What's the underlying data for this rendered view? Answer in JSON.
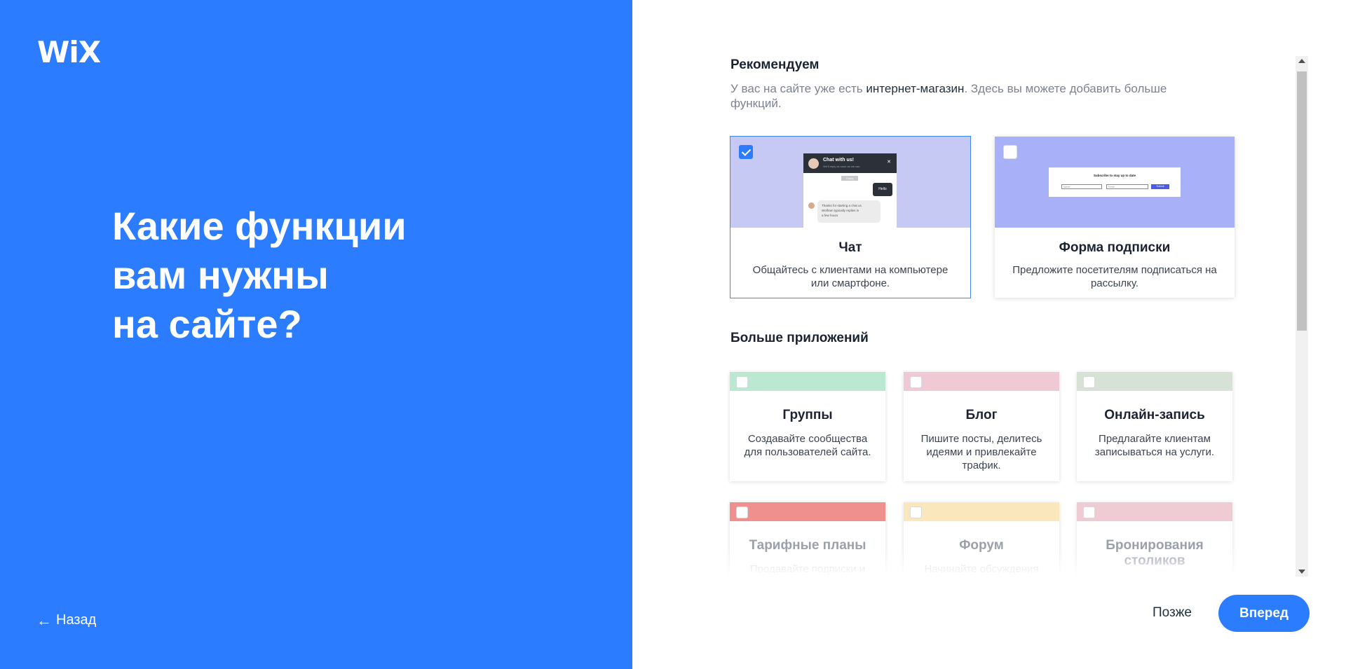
{
  "left": {
    "logo": "WiX",
    "headline": [
      "Какие функции",
      "вам нужны",
      "на сайте?"
    ],
    "back_label": "Назад",
    "back_arrow": "←"
  },
  "recommended": {
    "title": "Рекомендуем",
    "subtitle_before": "У вас на сайте уже есть ",
    "subtitle_emph": "интернет-магазин",
    "subtitle_after": ". Здесь вы можете добавить больше функций.",
    "cards": [
      {
        "title": "Чат",
        "desc": "Общайтесь с клиентами на компьютере или смартфоне.",
        "checked": true,
        "preview": {
          "bg": "#c7c9f5",
          "chat_title": "Chat with us!",
          "chat_sub": "We'll reply as soon as we can",
          "chat_close": "✕",
          "chat_pill": "Today",
          "chat_msg_out": "Hello",
          "chat_msg_in_1": "Thanks for starting a chat us.",
          "chat_msg_in_2": "Wolfram typically replies in",
          "chat_msg_in_3": "a few hours"
        }
      },
      {
        "title": "Форма подписки",
        "desc": "Предложите посетителям подписаться на рассылку.",
        "checked": false,
        "preview": {
          "bg": "#a8b0f7",
          "form_title": "Subscribe to stay up to date",
          "field1": "Name",
          "field2": "Email",
          "submit": "Submit"
        }
      }
    ]
  },
  "more_apps": {
    "title": "Больше приложений",
    "cards": [
      {
        "title": "Группы",
        "desc": "Создавайте сообщества для пользователей сайта.",
        "band": "#bbe8d0"
      },
      {
        "title": "Блог",
        "desc": "Пишите посты, делитесь идеями и привлекайте трафик.",
        "band": "#efc9d3"
      },
      {
        "title": "Онлайн-запись",
        "desc": "Предлагайте клиентам записываться на услуги.",
        "band": "#d6e2d6"
      },
      {
        "title": "Тарифные планы",
        "desc": "Продавайте подписки и",
        "band": "#f0908e"
      },
      {
        "title": "Форум",
        "desc": "Начинайте обсуждения",
        "band": "#fbe7bc"
      },
      {
        "title": "Бронирования столиков",
        "desc": "",
        "band": "#efcbd4"
      }
    ]
  },
  "footer": {
    "later_label": "Позже",
    "next_label": "Вперед"
  }
}
